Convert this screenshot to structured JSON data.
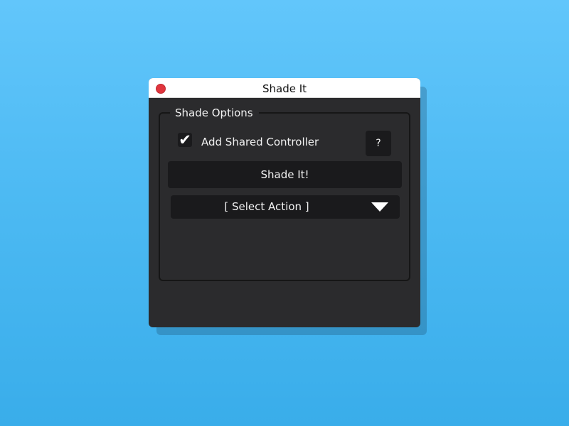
{
  "window": {
    "title": "Shade It"
  },
  "group": {
    "legend": "Shade Options"
  },
  "checkbox": {
    "label": "Add Shared Controller",
    "checked": true,
    "check_glyph": "✔"
  },
  "help_button": {
    "label": "?"
  },
  "shade_button": {
    "label": "Shade It!"
  },
  "action_select": {
    "value": "[ Select Action ]"
  },
  "colors": {
    "close": "#e0353d",
    "panel": "#2b2b2d",
    "control": "#1a1a1c",
    "background": "#4dbaf3"
  }
}
